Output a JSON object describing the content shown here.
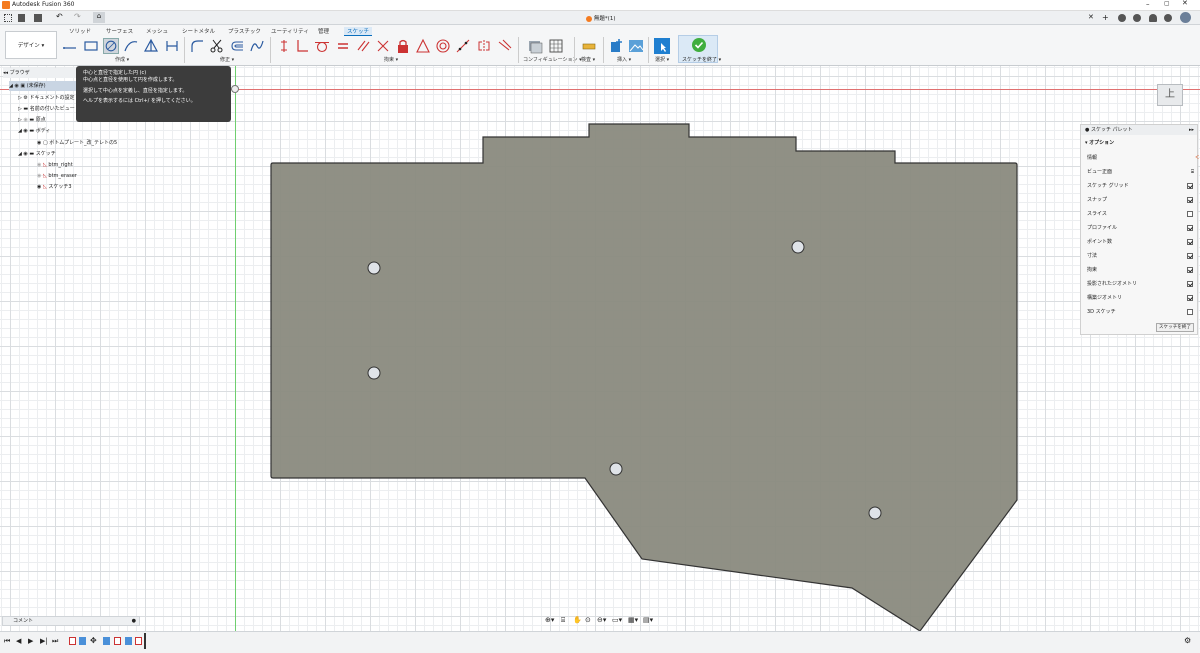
{
  "app": {
    "title": "Autodesk Fusion 360",
    "doc_title": "無題*(1)"
  },
  "workspace": {
    "label": "デザイン"
  },
  "ribbon_tabs": [
    "ソリッド",
    "サーフェス",
    "メッシュ",
    "シートメタル",
    "プラスチック",
    "ユーティリティ",
    "管理",
    "スケッチ"
  ],
  "groups": {
    "create": "作成",
    "modify": "修正",
    "constraints": "拘束",
    "configure": "コンフィギュレーション",
    "inspect": "検査",
    "insert": "挿入",
    "select": "選択",
    "finish": "スケッチを終了"
  },
  "tooltip": {
    "line1": "中心と直径で指定した円 (c)",
    "line2": "中心点と直径を使用して円を作成します。",
    "line3": "選択して中心点を定義し、直径を指定します。",
    "line4": "ヘルプを表示するには Ctrl+/ を押してください。"
  },
  "browser": {
    "header": "ブラウザ",
    "root": "(未保存)",
    "items": [
      "ドキュメントの設定",
      "名前の付いたビュー",
      "原点",
      "ボディ",
      "ボトムプレート_改_テレトの5",
      "スケッチ",
      "btm_right",
      "btm_eraser",
      "スケッチ3"
    ]
  },
  "palette": {
    "title": "スケッチ パレット",
    "section": "オプション",
    "rows": [
      {
        "label": "情報",
        "checked": null
      },
      {
        "label": "ビュー正面",
        "checked": null
      },
      {
        "label": "スケッチ グリッド",
        "checked": true
      },
      {
        "label": "スナップ",
        "checked": true
      },
      {
        "label": "スライス",
        "checked": false
      },
      {
        "label": "プロファイル",
        "checked": true
      },
      {
        "label": "ポイント数",
        "checked": true
      },
      {
        "label": "寸法",
        "checked": true
      },
      {
        "label": "拘束",
        "checked": true
      },
      {
        "label": "投影されたジオメトリ",
        "checked": true
      },
      {
        "label": "構築ジオメトリ",
        "checked": true
      },
      {
        "label": "3D スケッチ",
        "checked": false
      }
    ],
    "finish_button": "スケッチを終了"
  },
  "viewcube": {
    "label": "上"
  },
  "comment": {
    "label": "コメント"
  },
  "colors": {
    "body": "#8a8a7e",
    "accent": "#0a6ebd",
    "finish_green": "#3fae3f"
  }
}
